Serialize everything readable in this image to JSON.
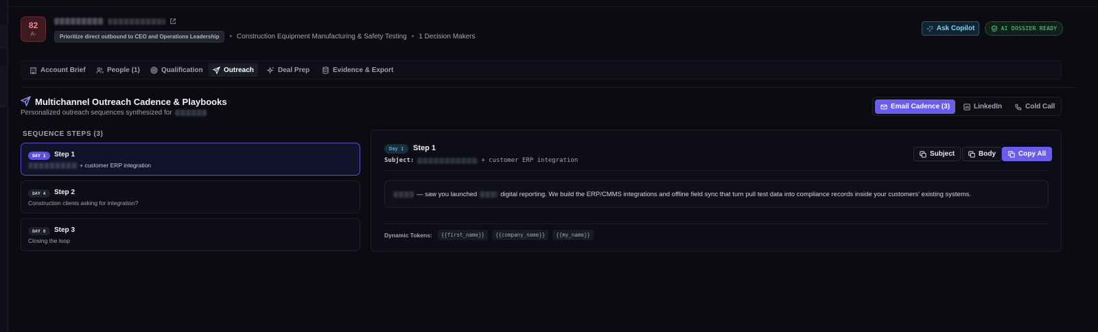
{
  "header": {
    "score": "82",
    "grade": "A-",
    "priority": "Prioritize direct outbound to CEO and Operations Leadership",
    "industry": "Construction Equipment Manufacturing & Safety Testing",
    "decision_makers": "1 Decision Makers",
    "ask_copilot": "Ask Copilot",
    "dossier_status": "AI DOSSIER READY"
  },
  "tabs": [
    {
      "label": "Account Brief",
      "icon": "building-icon"
    },
    {
      "label": "People (1)",
      "icon": "people-icon"
    },
    {
      "label": "Qualification",
      "icon": "target-icon"
    },
    {
      "label": "Outreach",
      "icon": "send-icon"
    },
    {
      "label": "Deal Prep",
      "icon": "sparkles-icon"
    },
    {
      "label": "Evidence & Export",
      "icon": "database-icon"
    }
  ],
  "active_tab": "Outreach",
  "section": {
    "title": "Multichannel Outreach Cadence & Playbooks",
    "subtitle": "Personalized outreach sequences synthesized for"
  },
  "channels": [
    {
      "label": "Email Cadence (3)",
      "icon": "mail-icon",
      "active": true
    },
    {
      "label": "LinkedIn",
      "icon": "linkedin-icon",
      "active": false
    },
    {
      "label": "Cold Call",
      "icon": "phone-icon",
      "active": false
    }
  ],
  "sequence": {
    "label": "SEQUENCE STEPS (3)",
    "steps": [
      {
        "day": "DAY 1",
        "title": "Step 1",
        "subtitle": "+ customer ERP integration"
      },
      {
        "day": "DAY 4",
        "title": "Step 2",
        "subtitle": "Construction clients asking for integration?"
      },
      {
        "day": "DAY 8",
        "title": "Step 3",
        "subtitle": "Closing the loop"
      }
    ]
  },
  "detail": {
    "day": "Day 1",
    "title": "Step 1",
    "subject_label": "Subject:",
    "subject_value": "+ customer ERP integration",
    "buttons": {
      "subject": "Subject",
      "body": "Body",
      "copy_all": "Copy All"
    },
    "body_part1": "— saw you launched",
    "body_part2": "digital reporting. We build the ERP/CMMS integrations and offline field sync that turn pull test data into compliance records inside your customers' existing systems.",
    "tokens_label": "Dynamic Tokens:",
    "tokens": [
      "{{first_name}}",
      "{{company_name}}",
      "{{my_name}}"
    ]
  },
  "colors": {
    "accent": "#6a5cf0",
    "copilot": "#7fd4f5",
    "ready": "#5fd895",
    "score": "#f08a95"
  }
}
